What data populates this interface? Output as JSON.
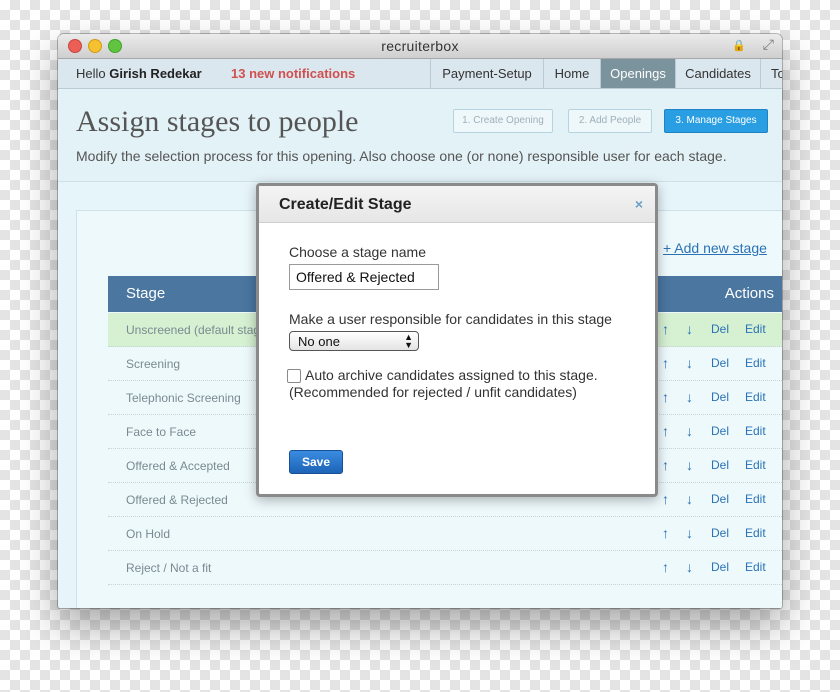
{
  "window": {
    "title": "recruiterbox"
  },
  "navbar": {
    "hello_prefix": "Hello ",
    "user_name": "Girish Redekar",
    "notifications": "13 new notifications",
    "items": [
      "Payment-Setup",
      "Home",
      "Openings",
      "Candidates",
      "To"
    ],
    "active_item": "Openings"
  },
  "header": {
    "title": "Assign stages to people",
    "subtitle": "Modify the selection process for this opening. Also choose one (or none) responsible user for each stage.",
    "steps": [
      "1. Create Opening",
      "2. Add People",
      "3. Manage Stages"
    ],
    "current_step": "3. Manage Stages"
  },
  "table": {
    "add_new_link": "+ Add new stage",
    "col_stage": "Stage",
    "col_actions": "Actions",
    "up_arrow": "↑",
    "down_arrow": "↓",
    "del_label": "Del",
    "edit_label": "Edit",
    "rows": [
      {
        "name": "Unscreened (default stage)"
      },
      {
        "name": "Screening"
      },
      {
        "name": "Telephonic Screening"
      },
      {
        "name": "Face to Face"
      },
      {
        "name": "Offered & Accepted"
      },
      {
        "name": "Offered & Rejected"
      },
      {
        "name": "On Hold"
      },
      {
        "name": "Reject / Not a fit"
      }
    ]
  },
  "modal": {
    "title": "Create/Edit Stage",
    "close_icon": "×",
    "name_label": "Choose a stage name",
    "name_value": "Offered & Rejected",
    "user_label": "Make a user responsible for candidates in this stage",
    "user_select_value": "No one",
    "auto_archive_label": "Auto archive candidates assigned to this stage.",
    "auto_archive_note": "(Recommended for rejected / unfit candidates)",
    "auto_archive_checked": false,
    "save_label": "Save"
  },
  "colors": {
    "accent": "#2a9ee3",
    "table_header": "#4a76a0",
    "notification": "#d0504f",
    "link": "#2a72b5"
  }
}
